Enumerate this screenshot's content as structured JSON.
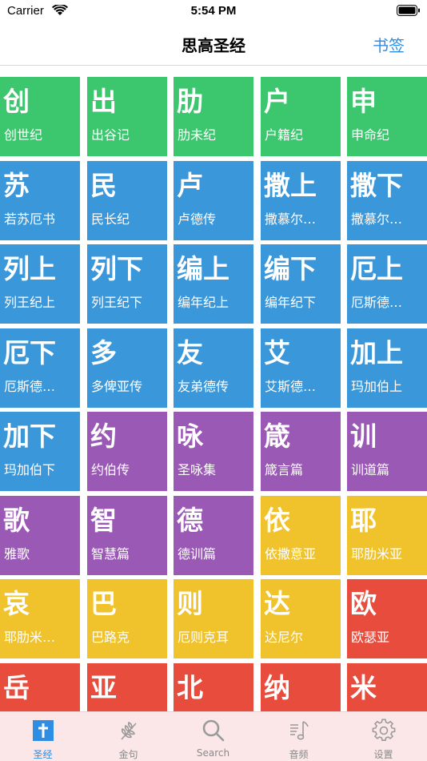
{
  "status": {
    "carrier": "Carrier",
    "time": "5:54 PM"
  },
  "nav": {
    "title": "思高圣经",
    "bookmark_label": "书签"
  },
  "colors": {
    "green": "#3cc66e",
    "blue": "#3a97d9",
    "purple": "#9b59b6",
    "yellow": "#f0c22b",
    "red": "#e74c3c",
    "accent": "#2f8de4"
  },
  "books": [
    {
      "abbr": "创",
      "name": "创世纪",
      "color": "green"
    },
    {
      "abbr": "出",
      "name": "出谷记",
      "color": "green"
    },
    {
      "abbr": "肋",
      "name": "肋未纪",
      "color": "green"
    },
    {
      "abbr": "户",
      "name": "户籍纪",
      "color": "green"
    },
    {
      "abbr": "申",
      "name": "申命纪",
      "color": "green"
    },
    {
      "abbr": "苏",
      "name": "若苏厄书",
      "color": "blue"
    },
    {
      "abbr": "民",
      "name": "民长纪",
      "color": "blue"
    },
    {
      "abbr": "卢",
      "name": "卢德传",
      "color": "blue"
    },
    {
      "abbr": "撒上",
      "name": "撒慕尔…",
      "color": "blue"
    },
    {
      "abbr": "撒下",
      "name": "撒慕尔…",
      "color": "blue"
    },
    {
      "abbr": "列上",
      "name": "列王纪上",
      "color": "blue"
    },
    {
      "abbr": "列下",
      "name": "列王纪下",
      "color": "blue"
    },
    {
      "abbr": "编上",
      "name": "编年纪上",
      "color": "blue"
    },
    {
      "abbr": "编下",
      "name": "编年纪下",
      "color": "blue"
    },
    {
      "abbr": "厄上",
      "name": "厄斯德…",
      "color": "blue"
    },
    {
      "abbr": "厄下",
      "name": "厄斯德…",
      "color": "blue"
    },
    {
      "abbr": "多",
      "name": "多俾亚传",
      "color": "blue"
    },
    {
      "abbr": "友",
      "name": "友弟德传",
      "color": "blue"
    },
    {
      "abbr": "艾",
      "name": "艾斯德…",
      "color": "blue"
    },
    {
      "abbr": "加上",
      "name": "玛加伯上",
      "color": "blue"
    },
    {
      "abbr": "加下",
      "name": "玛加伯下",
      "color": "blue"
    },
    {
      "abbr": "约",
      "name": "约伯传",
      "color": "purple"
    },
    {
      "abbr": "咏",
      "name": "圣咏集",
      "color": "purple"
    },
    {
      "abbr": "箴",
      "name": "箴言篇",
      "color": "purple"
    },
    {
      "abbr": "训",
      "name": "训道篇",
      "color": "purple"
    },
    {
      "abbr": "歌",
      "name": "雅歌",
      "color": "purple"
    },
    {
      "abbr": "智",
      "name": "智慧篇",
      "color": "purple"
    },
    {
      "abbr": "德",
      "name": "德训篇",
      "color": "purple"
    },
    {
      "abbr": "依",
      "name": "依撒意亚",
      "color": "yellow"
    },
    {
      "abbr": "耶",
      "name": "耶肋米亚",
      "color": "yellow"
    },
    {
      "abbr": "哀",
      "name": "耶肋米…",
      "color": "yellow"
    },
    {
      "abbr": "巴",
      "name": "巴路克",
      "color": "yellow"
    },
    {
      "abbr": "则",
      "name": "厄则克耳",
      "color": "yellow"
    },
    {
      "abbr": "达",
      "name": "达尼尔",
      "color": "yellow"
    },
    {
      "abbr": "欧",
      "name": "欧瑟亚",
      "color": "red"
    },
    {
      "abbr": "岳",
      "name": "",
      "color": "red"
    },
    {
      "abbr": "亚",
      "name": "",
      "color": "red"
    },
    {
      "abbr": "北",
      "name": "",
      "color": "red"
    },
    {
      "abbr": "纳",
      "name": "",
      "color": "red"
    },
    {
      "abbr": "米",
      "name": "",
      "color": "red"
    }
  ],
  "tabs": [
    {
      "label": "圣经",
      "icon": "bible-icon",
      "active": true
    },
    {
      "label": "金句",
      "icon": "wheat-icon",
      "active": false
    },
    {
      "label": "Search",
      "icon": "search-icon",
      "active": false
    },
    {
      "label": "音频",
      "icon": "music-note-icon",
      "active": false
    },
    {
      "label": "设置",
      "icon": "gear-icon",
      "active": false
    }
  ]
}
